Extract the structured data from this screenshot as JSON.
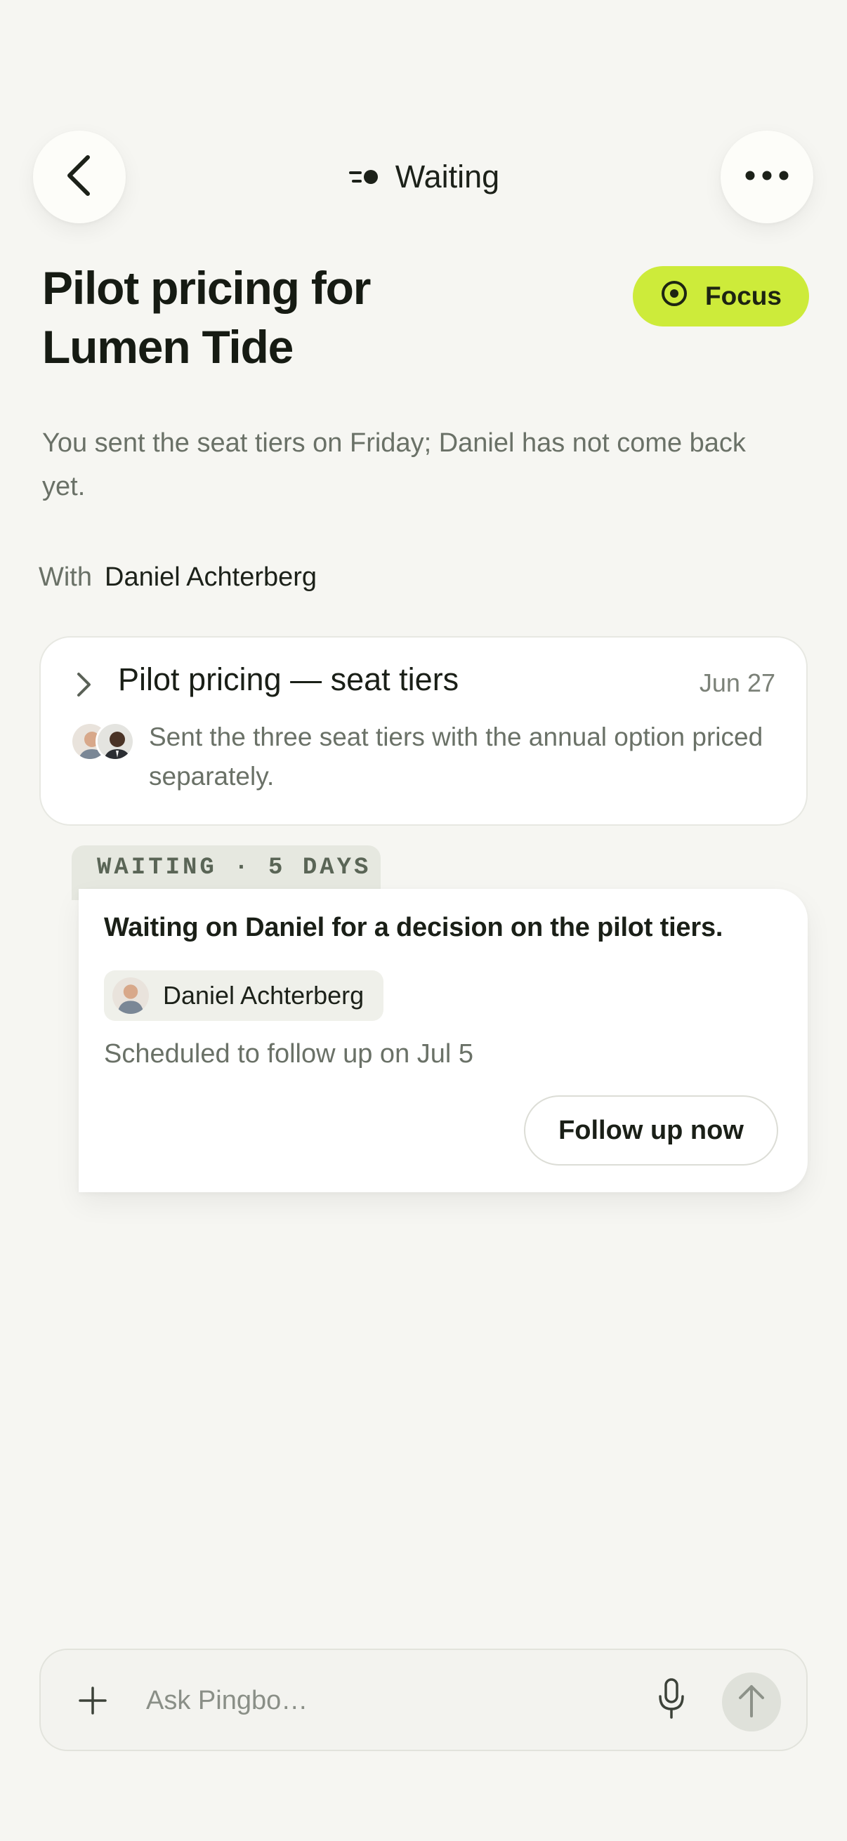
{
  "header": {
    "status_label": "Waiting",
    "status_icon": "waiting-dots-icon",
    "back_icon": "chevron-left-icon",
    "more_icon": "more-horizontal-icon"
  },
  "task": {
    "title": "Pilot pricing for Lumen Tide",
    "focus_label": "Focus",
    "focus_color": "#cdeb3a",
    "summary": "You sent the seat tiers on Friday; Daniel has not come back yet.",
    "with_label": "With",
    "with_name": "Daniel Achterberg"
  },
  "thread": {
    "title": "Pilot pricing — seat tiers",
    "date": "Jun 27",
    "snippet": "Sent the three seat tiers with the annual option priced separately."
  },
  "waiting": {
    "tab_label": "WAITING · 5 DAYS",
    "message": "Waiting on Daniel for a decision on the pilot tiers.",
    "person_name": "Daniel Achterberg",
    "schedule": "Scheduled to follow up on Jul 5",
    "follow_up_label": "Follow up now"
  },
  "composer": {
    "placeholder": "Ask Pingbo…"
  }
}
